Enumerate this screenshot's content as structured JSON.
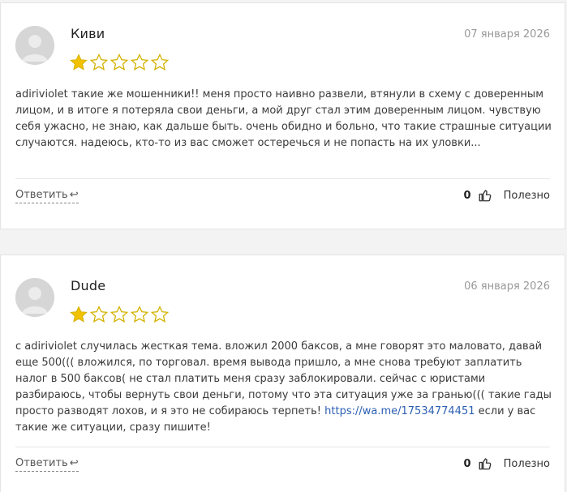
{
  "reviews": [
    {
      "author": "Киви",
      "date": "07 января 2026",
      "rating": 1,
      "max_rating": 5,
      "text": "adiriviolet такие же мошенники!! меня просто наивно развели, втянули в схему с доверенным лицом, и в итоге я потеряла свои деньги, а мой друг стал этим доверенным лицом. чувствую себя ужасно, не знаю, как дальше быть. очень обидно и больно, что такие страшные ситуации случаются. надеюсь, кто-то из вас сможет остеречься и не попасть на их уловки...",
      "reply_label": "Ответить",
      "useful_count": "0",
      "useful_label": "Полезно"
    },
    {
      "author": "Dude",
      "date": "06 января 2026",
      "rating": 1,
      "max_rating": 5,
      "text_before_link": "с adiriviolet случилась жесткая тема. вложил 2000 баксов, а мне говорят это маловато, давай еще 500((( вложился, по торговал. время вывода пришло, а мне снова требуют заплатить налог в 500 баксов( не стал платить меня сразу заблокировали. сейчас с юристами разбираюсь, чтобы вернуть свои деньги, потому что эта ситуация уже за гранью((( такие гады просто разводят лохов, и я это не собираюсь терпеть! ",
      "link_text": "https://wa.me/17534774451",
      "text_after_link": " если у вас такие же ситуации, сразу пишите!",
      "reply_label": "Ответить",
      "useful_count": "0",
      "useful_label": "Полезно"
    }
  ],
  "colors": {
    "star_filled": "#f2c200",
    "star_empty_stroke": "#d4b200",
    "link": "#2b5fb3"
  },
  "icons": {
    "reply": "reply-arrow-icon",
    "useful": "thumbs-up-icon",
    "avatar": "user-placeholder-avatar"
  }
}
